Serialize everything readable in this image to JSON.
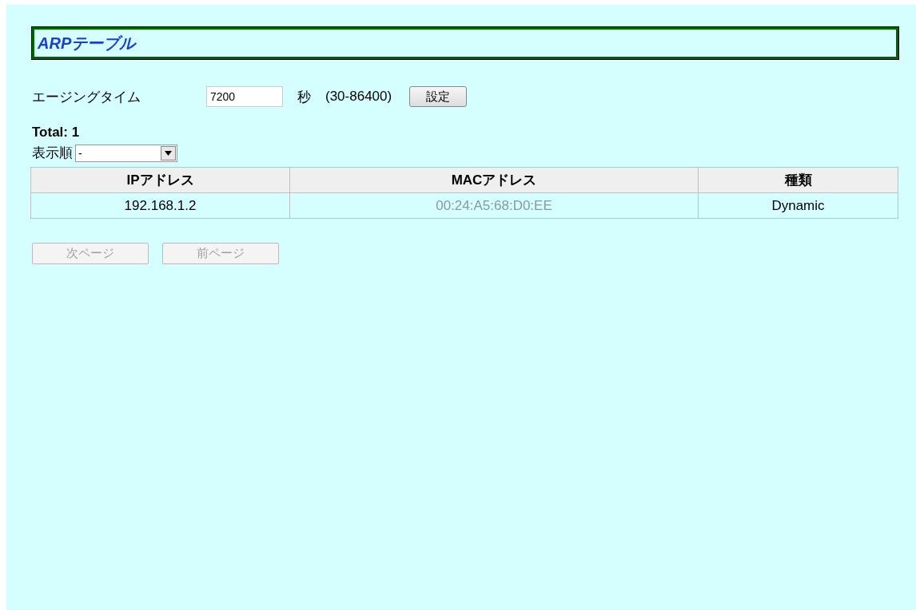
{
  "title": "ARPテーブル",
  "aging": {
    "label": "エージングタイム",
    "value": "7200",
    "unit": "秒",
    "range": "(30-86400)",
    "button": "設定"
  },
  "total": "Total: 1",
  "sort": {
    "label": "表示順",
    "value": "-"
  },
  "table": {
    "columns": [
      "IPアドレス",
      "MACアドレス",
      "種類"
    ],
    "rows": [
      {
        "cells": [
          "192.168.1.2",
          "00:24:A5:68:D0:EE",
          "Dynamic"
        ],
        "blurred": [
          false,
          true,
          false
        ]
      }
    ]
  },
  "pager": [
    {
      "label": "次ページ",
      "disabled": true
    },
    {
      "label": "前ページ",
      "disabled": true
    }
  ]
}
